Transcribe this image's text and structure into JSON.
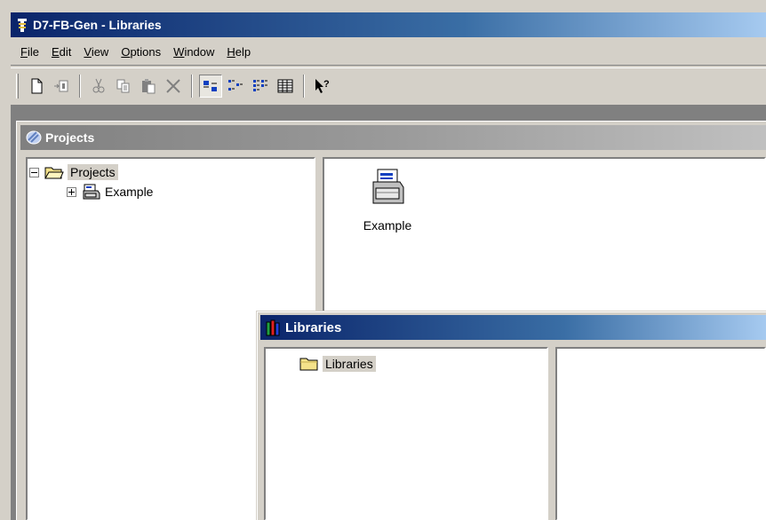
{
  "app": {
    "title": "D7-FB-Gen - Libraries"
  },
  "menu": {
    "items": [
      {
        "first": "F",
        "rest": "ile"
      },
      {
        "first": "E",
        "rest": "dit"
      },
      {
        "first": "V",
        "rest": "iew"
      },
      {
        "first": "O",
        "rest": "ptions"
      },
      {
        "first": "W",
        "rest": "indow"
      },
      {
        "first": "H",
        "rest": "elp"
      }
    ]
  },
  "toolbar": {
    "buttons": [
      "new-icon",
      "copy-to-icon",
      "cut-icon",
      "copy-icon",
      "paste-icon",
      "delete-icon",
      "large-icons-icon",
      "small-icons-icon",
      "list-icon",
      "details-icon",
      "context-help-icon"
    ],
    "pressed": "large-icons-icon"
  },
  "projects_window": {
    "title": "Projects",
    "tree": [
      {
        "label": "Projects",
        "expanded": true,
        "selected": true
      },
      {
        "label": "Example",
        "expanded": false,
        "selected": false
      }
    ],
    "items": [
      {
        "label": "Example"
      }
    ]
  },
  "libraries_window": {
    "title": "Libraries",
    "tree": [
      {
        "label": "Libraries",
        "selected": true
      }
    ]
  },
  "colors": {
    "active_title": "#0a246a",
    "inactive_title": "#808080",
    "face": "#d4d0c8",
    "folder": "#f4e28a"
  }
}
